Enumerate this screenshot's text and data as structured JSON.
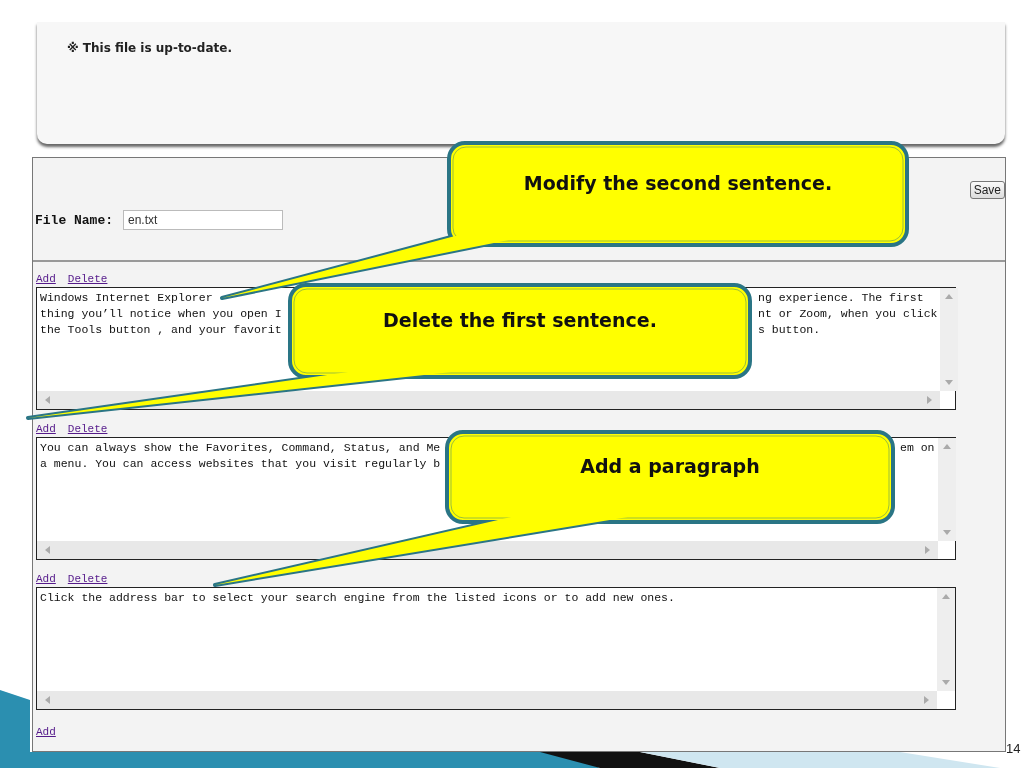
{
  "notice": {
    "mark": "※",
    "text": "This file is up-to-date."
  },
  "form": {
    "save_button": "Save",
    "file_name_label": "File Name:",
    "file_name_value": "en.txt"
  },
  "paragraphs": [
    {
      "add_link": "Add",
      "delete_link": "Delete",
      "lines": [
        {
          "left": "Windows Internet Explorer",
          "right": "ng experience. The first"
        },
        {
          "left": "thing you’ll notice when you open I",
          "right": "nt or Zoom, when you click"
        },
        {
          "left": "the Tools button , and your favorit",
          "right": "s button."
        }
      ]
    },
    {
      "add_link": "Add",
      "delete_link": "Delete",
      "lines": [
        {
          "left": "You can always show the Favorites, Command, Status, and Me",
          "right": "em on"
        },
        {
          "left": "a menu. You can access websites that you visit regularly b"
        }
      ]
    },
    {
      "add_link": "Add",
      "delete_link": "Delete",
      "lines": [
        {
          "left": "Click the address bar to select your search engine from the listed icons or to add new ones."
        }
      ]
    }
  ],
  "final_add_link": "Add",
  "callouts": [
    {
      "text": "Modify the second sentence."
    },
    {
      "text": "Delete the first sentence."
    },
    {
      "text": "Add a paragraph"
    }
  ],
  "slide_number": "14"
}
